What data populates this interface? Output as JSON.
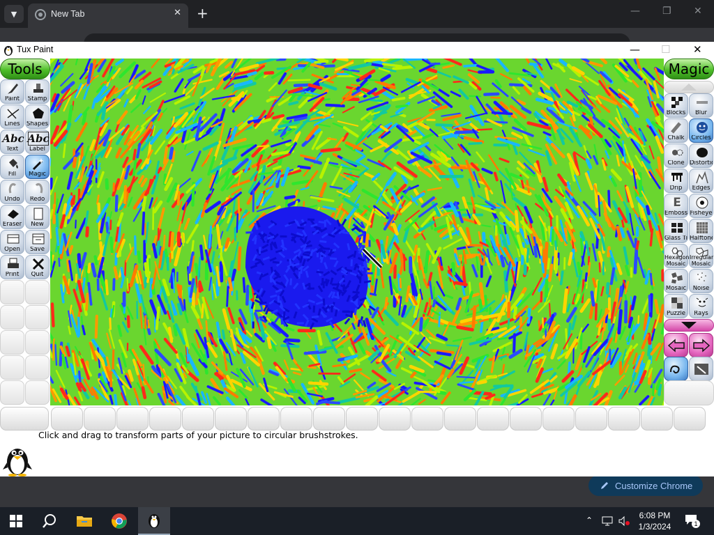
{
  "browser": {
    "tab_title": "New Tab",
    "new_tab_symbol": "+",
    "customize_label": "Customize Chrome"
  },
  "tuxpaint": {
    "window_title": "Tux Paint",
    "tools_header": "Tools",
    "magic_header": "Magic",
    "tools": [
      {
        "label": "Paint",
        "icon": "paint-brush-icon"
      },
      {
        "label": "Stamp",
        "icon": "stamp-icon"
      },
      {
        "label": "Lines",
        "icon": "lines-icon"
      },
      {
        "label": "Shapes",
        "icon": "shapes-icon"
      },
      {
        "label": "Text",
        "icon": "text-icon"
      },
      {
        "label": "Label",
        "icon": "label-icon"
      },
      {
        "label": "Fill",
        "icon": "fill-bucket-icon"
      },
      {
        "label": "Magic",
        "icon": "magic-wand-icon",
        "selected": true
      },
      {
        "label": "Undo",
        "icon": "undo-icon"
      },
      {
        "label": "Redo",
        "icon": "redo-icon"
      },
      {
        "label": "Eraser",
        "icon": "eraser-icon"
      },
      {
        "label": "New",
        "icon": "new-page-icon"
      },
      {
        "label": "Open",
        "icon": "open-icon"
      },
      {
        "label": "Save",
        "icon": "save-icon"
      },
      {
        "label": "Print",
        "icon": "print-icon"
      },
      {
        "label": "Quit",
        "icon": "quit-icon"
      }
    ],
    "magic_tools": [
      {
        "label": "Blocks",
        "icon": "blocks-icon"
      },
      {
        "label": "Blur",
        "icon": "blur-icon"
      },
      {
        "label": "Chalk",
        "icon": "chalk-icon"
      },
      {
        "label": "Circles",
        "icon": "circles-icon",
        "selected": true
      },
      {
        "label": "Clone",
        "icon": "clone-icon"
      },
      {
        "label": "Distortion",
        "icon": "distortion-icon"
      },
      {
        "label": "Drip",
        "icon": "drip-icon"
      },
      {
        "label": "Edges",
        "icon": "edges-icon"
      },
      {
        "label": "Emboss",
        "icon": "emboss-icon"
      },
      {
        "label": "Fisheye",
        "icon": "fisheye-icon"
      },
      {
        "label": "Glass Tile",
        "icon": "glass-tile-icon"
      },
      {
        "label": "Halftone",
        "icon": "halftone-icon"
      },
      {
        "label": "Hexagon Mosaic",
        "label_lines": [
          "Hexagon",
          "Mosaic"
        ],
        "icon": "hexagon-mosaic-icon"
      },
      {
        "label": "Irregular Mosaic",
        "label_lines": [
          "Irregular",
          "Mosaic"
        ],
        "icon": "irregular-mosaic-icon"
      },
      {
        "label": "Mosaic",
        "icon": "mosaic-icon"
      },
      {
        "label": "Noise",
        "icon": "noise-icon"
      },
      {
        "label": "Puzzle",
        "icon": "puzzle-icon"
      },
      {
        "label": "Rays",
        "icon": "rays-icon"
      }
    ],
    "status_message": "Click and drag to transform parts of your picture to circular brushstrokes."
  },
  "taskbar": {
    "time": "6:08 PM",
    "date": "1/3/2024",
    "notification_count": "1"
  },
  "colors": {
    "tools_header_green": "#4fbf2a",
    "selected_button_blue": "#3d79c2",
    "magic_scroll_pink": "#d447a8"
  }
}
